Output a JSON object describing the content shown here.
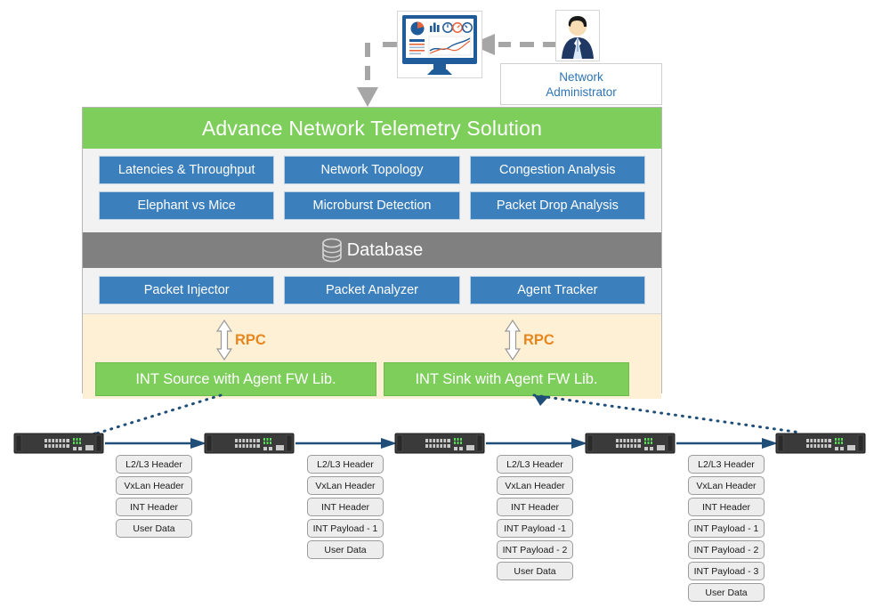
{
  "top": {
    "monitor_icon": "dashboard-monitor",
    "admin_icon": "person-avatar",
    "admin_label": "Network\nAdministrator",
    "admin_label_line1": "Network",
    "admin_label_line2": "Administrator"
  },
  "solution": {
    "title": "Advance Network Telemetry Solution",
    "features_row1": [
      "Latencies & Throughput",
      "Network Topology",
      "Congestion Analysis"
    ],
    "features_row2": [
      "Elephant vs Mice",
      "Microburst Detection",
      "Packet Drop Analysis"
    ],
    "database_label": "Database",
    "database_icon": "database-cylinder-icon",
    "services": [
      "Packet Injector",
      "Packet Analyzer",
      "Agent Tracker"
    ],
    "rpc": {
      "label_left": "RPC",
      "label_right": "RPC",
      "arrow_icon": "double-headed-vertical-arrow"
    },
    "agents": [
      "INT Source with Agent FW Lib.",
      "INT Sink with Agent FW Lib."
    ]
  },
  "network": {
    "switch_icon": "network-switch-icon",
    "switch_count": 5,
    "packet_stacks": [
      {
        "layers": [
          "L2/L3 Header",
          "VxLan Header",
          "INT Header",
          "User Data"
        ]
      },
      {
        "layers": [
          "L2/L3 Header",
          "VxLan Header",
          "INT Header",
          "INT Payload - 1",
          "User Data"
        ]
      },
      {
        "layers": [
          "L2/L3 Header",
          "VxLan Header",
          "INT Header",
          "INT Payload -1",
          "INT Payload - 2",
          "User Data"
        ]
      },
      {
        "layers": [
          "L2/L3 Header",
          "VxLan Header",
          "INT Header",
          "INT Payload - 1",
          "INT Payload - 2",
          "INT Payload - 3",
          "User Data"
        ]
      }
    ]
  },
  "colors": {
    "green": "#7DCE5A",
    "blue": "#3C7FBD",
    "gray_bar": "#808080",
    "cream": "#FDF0D5",
    "orange": "#E8861E",
    "panel": "#F2F2F2",
    "link_blue": "#1F4E79",
    "label_blue": "#2E74B5",
    "switch_body": "#333333"
  }
}
